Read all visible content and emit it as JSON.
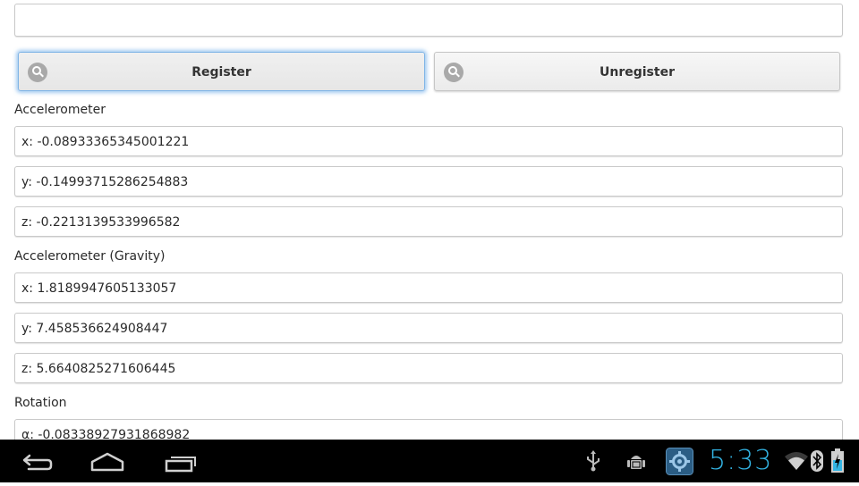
{
  "top_input": {
    "value": ""
  },
  "buttons": {
    "register_label": "Register",
    "unregister_label": "Unregister"
  },
  "sections": [
    {
      "title": "Accelerometer",
      "values": [
        "x: -0.08933365345001221",
        "y: -0.14993715286254883",
        "z: -0.2213139533996582"
      ]
    },
    {
      "title": "Accelerometer (Gravity)",
      "values": [
        "x: 1.8189947605133057",
        "y: 7.458536624908447",
        "z: 5.6640825271606445"
      ]
    },
    {
      "title": "Rotation",
      "values": [
        "α: -0.08338927931868982"
      ]
    }
  ],
  "status_bar": {
    "time": "5:33",
    "accent_color": "#33b5e5",
    "icons": [
      "usb-icon",
      "android-debug-icon",
      "settings-app-icon",
      "wifi-icon",
      "bluetooth-icon",
      "battery-charging-icon"
    ]
  },
  "nav_bar": {
    "icons": [
      "back-icon",
      "home-icon",
      "recent-apps-icon"
    ]
  }
}
